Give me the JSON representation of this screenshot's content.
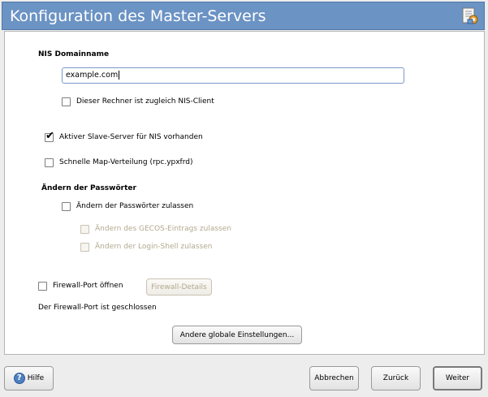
{
  "window": {
    "title": "Konfiguration des Master-Servers"
  },
  "nis": {
    "domain_label": "NIS Domainname",
    "domain_value": "example.com",
    "client_label": "Dieser Rechner ist zugleich NIS-Client",
    "client_checked": false,
    "slave_label": "Aktiver Slave-Server für NIS vorhanden",
    "slave_checked": true,
    "fast_map_label": "Schnelle Map-Verteilung (rpc.ypxfrd)",
    "fast_map_checked": false
  },
  "passwords": {
    "heading": "Ändern der Passwörter",
    "allow_label": "Ändern der Passwörter zulassen",
    "allow_checked": false,
    "gecos_label": "Ändern des GECOS-Eintrags zulassen",
    "shell_label": "Ändern der Login-Shell zulassen"
  },
  "firewall": {
    "open_port_label": "Firewall-Port öffnen",
    "details_button": "Firewall-Details",
    "status_text": "Der Firewall-Port ist geschlossen"
  },
  "other_settings_button": "Andere globale Einstellungen...",
  "footer": {
    "help": "Hilfe",
    "cancel": "Abbrechen",
    "back": "Zurück",
    "next": "Weiter"
  },
  "colors": {
    "titlebar": "#6b93c4",
    "disabled_text": "#b2a98f"
  },
  "icons": {
    "app": "settings-document-icon",
    "help": "help-icon",
    "check": "checkmark-icon"
  }
}
